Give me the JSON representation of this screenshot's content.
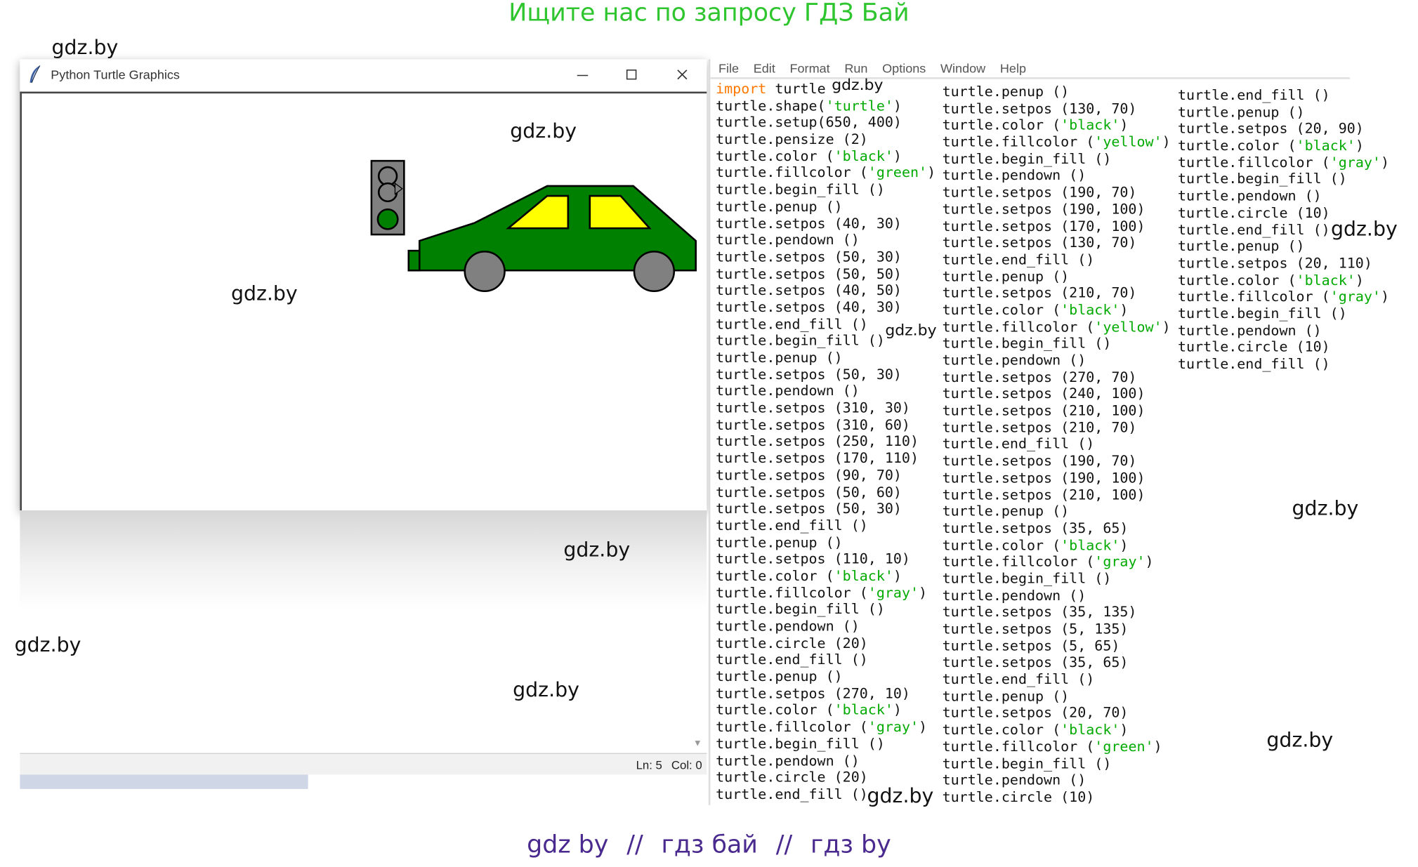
{
  "banner_top": "Ищите нас по запросу ГДЗ Бай",
  "banner_bottom": [
    "gdz by",
    "//",
    "гдз бай",
    "//",
    "гдз by"
  ],
  "watermark": "gdz.by",
  "turtle_window": {
    "title": "Python Turtle Graphics",
    "icon": "feather-icon",
    "controls": [
      "minimize-icon",
      "maximize-icon",
      "close-icon"
    ]
  },
  "drawing": {
    "car_color": "#008000",
    "window_color": "#ffff00",
    "wheel_color": "#808080",
    "light_housing_color": "#808080",
    "light_green": "#008000"
  },
  "status": {
    "line": "Ln: 5",
    "col": "Col: 0"
  },
  "editor": {
    "menu": [
      "File",
      "Edit",
      "Format",
      "Run",
      "Options",
      "Window",
      "Help"
    ],
    "columns": [
      [
        "import turtle",
        "turtle.shape('turtle')",
        "turtle.setup(650, 400)",
        "turtle.pensize (2)",
        "turtle.color ('black')",
        "turtle.fillcolor ('green')",
        "turtle.begin_fill ()",
        "turtle.penup ()",
        "turtle.setpos (40, 30)",
        "turtle.pendown ()",
        "turtle.setpos (50, 30)",
        "turtle.setpos (50, 50)",
        "turtle.setpos (40, 50)",
        "turtle.setpos (40, 30)",
        "turtle.end_fill ()",
        "turtle.begin_fill ()",
        "turtle.penup ()",
        "turtle.setpos (50, 30)",
        "turtle.pendown ()",
        "turtle.setpos (310, 30)",
        "turtle.setpos (310, 60)",
        "turtle.setpos (250, 110)",
        "turtle.setpos (170, 110)",
        "turtle.setpos (90, 70)",
        "turtle.setpos (50, 60)",
        "turtle.setpos (50, 30)",
        "turtle.end_fill ()",
        "turtle.penup ()",
        "turtle.setpos (110, 10)",
        "turtle.color ('black')",
        "turtle.fillcolor ('gray')",
        "turtle.begin_fill ()",
        "turtle.pendown ()",
        "turtle.circle (20)",
        "turtle.end_fill ()",
        "turtle.penup ()",
        "turtle.setpos (270, 10)",
        "turtle.color ('black')",
        "turtle.fillcolor ('gray')",
        "turtle.begin_fill ()",
        "turtle.pendown ()",
        "turtle.circle (20)",
        "turtle.end_fill ()"
      ],
      [
        "turtle.penup ()",
        "turtle.setpos (130, 70)",
        "turtle.color ('black')",
        "turtle.fillcolor ('yellow')",
        "turtle.begin_fill ()",
        "turtle.pendown ()",
        "turtle.setpos (190, 70)",
        "turtle.setpos (190, 100)",
        "turtle.setpos (170, 100)",
        "turtle.setpos (130, 70)",
        "turtle.end_fill ()",
        "turtle.penup ()",
        "turtle.setpos (210, 70)",
        "turtle.color ('black')",
        "turtle.fillcolor ('yellow')",
        "turtle.begin_fill ()",
        "turtle.pendown ()",
        "turtle.setpos (270, 70)",
        "turtle.setpos (240, 100)",
        "turtle.setpos (210, 100)",
        "turtle.setpos (210, 70)",
        "turtle.end_fill ()",
        "turtle.setpos (190, 70)",
        "turtle.setpos (190, 100)",
        "turtle.setpos (210, 100)",
        "turtle.penup ()",
        "turtle.setpos (35, 65)",
        "turtle.color ('black')",
        "turtle.fillcolor ('gray')",
        "turtle.begin_fill ()",
        "turtle.pendown ()",
        "turtle.setpos (35, 135)",
        "turtle.setpos (5, 135)",
        "turtle.setpos (5, 65)",
        "turtle.setpos (35, 65)",
        "turtle.end_fill ()",
        "turtle.penup ()",
        "turtle.setpos (20, 70)",
        "turtle.color ('black')",
        "turtle.fillcolor ('green')",
        "turtle.begin_fill ()",
        "turtle.pendown ()",
        "turtle.circle (10)"
      ],
      [
        "turtle.end_fill ()",
        "turtle.penup ()",
        "turtle.setpos (20, 90)",
        "turtle.color ('black')",
        "turtle.fillcolor ('gray')",
        "turtle.begin_fill ()",
        "turtle.pendown ()",
        "turtle.circle (10)",
        "turtle.end_fill ()",
        "turtle.penup ()",
        "turtle.setpos (20, 110)",
        "turtle.color ('black')",
        "turtle.fillcolor ('gray')",
        "turtle.begin_fill ()",
        "turtle.pendown ()",
        "turtle.circle (10)",
        "turtle.end_fill ()"
      ]
    ]
  }
}
